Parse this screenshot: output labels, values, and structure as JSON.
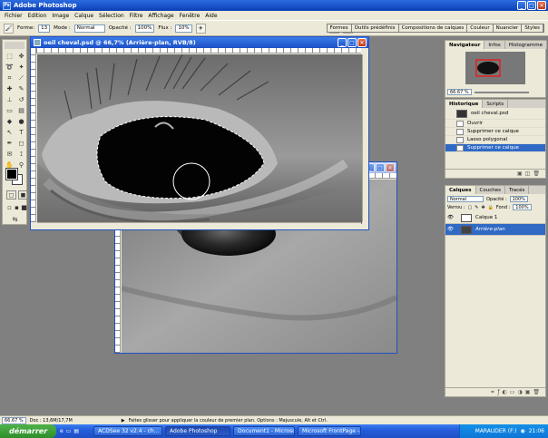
{
  "app": {
    "title": "Adobe Photoshop",
    "logo": "Ps"
  },
  "menu": [
    "Fichier",
    "Edition",
    "Image",
    "Calque",
    "Sélection",
    "Filtre",
    "Affichage",
    "Fenêtre",
    "Aide"
  ],
  "options": {
    "forme_label": "Forme:",
    "forme_value": "13",
    "mode_label": "Mode :",
    "mode_value": "Normal",
    "opacite_label": "Opacité :",
    "opacite_value": "100%",
    "flux_label": "Flux :",
    "flux_value": "10%"
  },
  "palette_well": [
    "Formes",
    "Outils prédéfinis",
    "Compositions de calques",
    "Couleur",
    "Nuancier",
    "Styles"
  ],
  "documents": {
    "front": {
      "title": "oeil cheval.psd @ 66,7% (Arrière-plan, RVB/8)"
    },
    "back": {
      "title": ""
    }
  },
  "navigator": {
    "tabs": [
      "Navigateur",
      "Infos",
      "Histogramme"
    ],
    "zoom": "66.67 %"
  },
  "history": {
    "tabs": [
      "Historique",
      "Scripts"
    ],
    "snapshot": "oeil cheval.psd",
    "items": [
      "Ouvrir",
      "Supprimer ce calque",
      "Lasso polygonal",
      "Supprimer ce calque"
    ]
  },
  "layers": {
    "tabs": [
      "Calques",
      "Couches",
      "Tracés"
    ],
    "blend_mode": "Normal",
    "opacity_label": "Opacité :",
    "opacity_value": "100%",
    "lock_label": "Verrou :",
    "fill_label": "Fond :",
    "fill_value": "100%",
    "items": [
      "Calque 1",
      "Arrière-plan"
    ]
  },
  "status": {
    "zoom": "66.67 %",
    "doc": "Doc : 13,6M/17,7M",
    "hint": "Faites glisser pour appliquer la couleur de premier plan. Options : Majuscule, Alt et Ctrl."
  },
  "taskbar": {
    "start": "démarrer",
    "tasks": [
      "ACDSee 32 v2.4 - ch...",
      "Adobe Photoshop",
      "Document1 - Microsof...",
      "Microsoft FrontPage -..."
    ],
    "user": "MARAUDER (F:)",
    "clock": "21:06"
  },
  "colors": {
    "foreground": "#000000",
    "background": "#ffffff",
    "accent": "#316ac5"
  }
}
